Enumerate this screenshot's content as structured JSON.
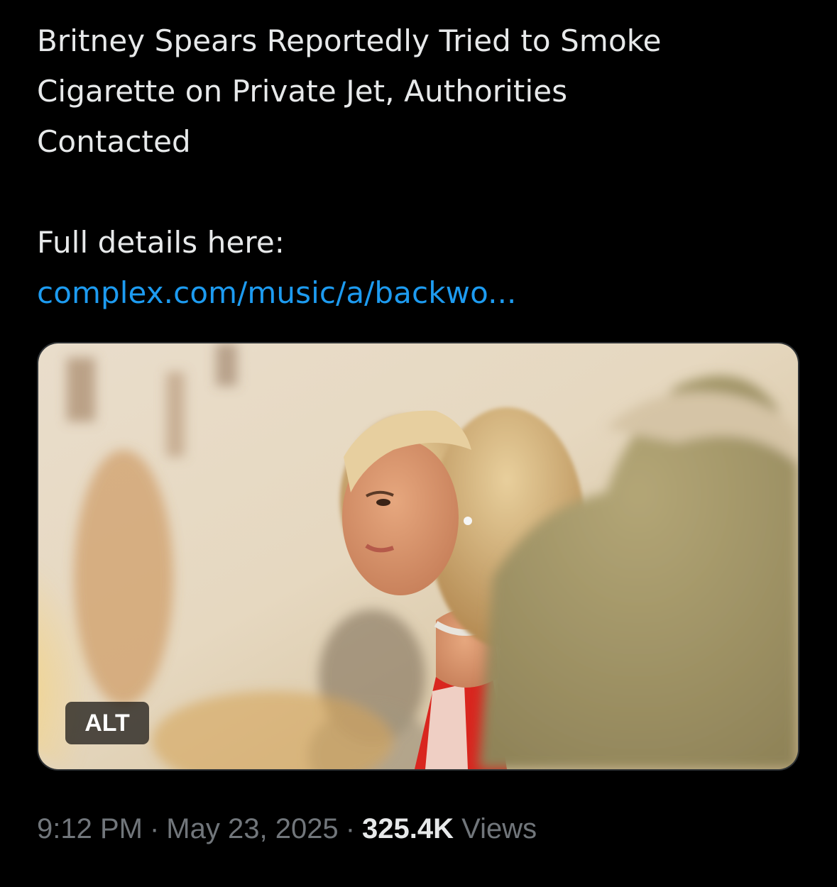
{
  "post": {
    "headline_lines": [
      "Britney Spears Reportedly Tried to Smoke",
      "Cigarette on Private Jet, Authorities",
      "Contacted"
    ],
    "details_prefix": "Full details here:",
    "link_text": "complex.com/music/a/backwo..."
  },
  "media": {
    "alt_label": "ALT"
  },
  "meta": {
    "time": "9:12 PM",
    "separator": "·",
    "date": "May 23, 2025",
    "views_count": "325.4K",
    "views_label": "Views"
  },
  "colors": {
    "background": "#000000",
    "text": "#e7e9ea",
    "link": "#1d9bf0",
    "secondary": "#71767b"
  }
}
